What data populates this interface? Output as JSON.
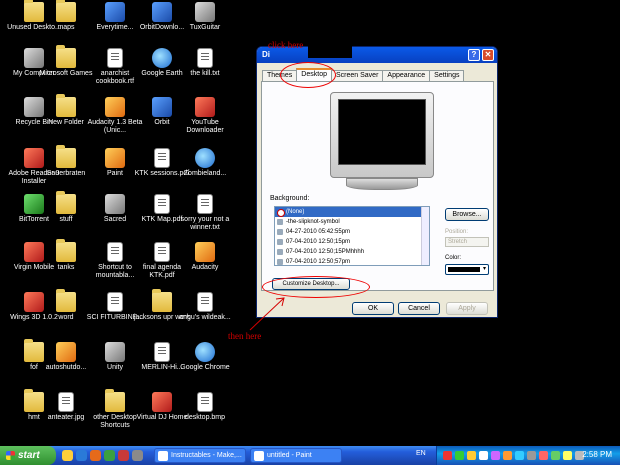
{
  "desktop": {
    "icons": [
      {
        "label": "Unused Deskto..."
      },
      {
        "label": "maps"
      },
      {
        "label": "Everytime..."
      },
      {
        "label": "OrbitDownlo..."
      },
      {
        "label": "TuxGuitar"
      },
      {
        "label": "My Computer"
      },
      {
        "label": "Microsoft Games"
      },
      {
        "label": "anarchist cookbook.rtf"
      },
      {
        "label": "Google Earth"
      },
      {
        "label": "the kill.txt"
      },
      {
        "label": "Recycle Bin"
      },
      {
        "label": "New Folder"
      },
      {
        "label": "Audacity 1.3 Beta (Unic..."
      },
      {
        "label": "Orbit"
      },
      {
        "label": "YouTube Downloader"
      },
      {
        "label": "Adobe Reader 9 Installer"
      },
      {
        "label": "Sauerbraten"
      },
      {
        "label": "Paint"
      },
      {
        "label": "KTK sessions.pdf"
      },
      {
        "label": "Zombieland..."
      },
      {
        "label": "BitTorrent"
      },
      {
        "label": "stuff"
      },
      {
        "label": "Sacred"
      },
      {
        "label": "KTK Map.pdf"
      },
      {
        "label": "sorry your not a winner.txt"
      },
      {
        "label": "Virgin Mobile"
      },
      {
        "label": "tanks"
      },
      {
        "label": "Shortcut to mountabla..."
      },
      {
        "label": "final agenda KTK.pdf"
      },
      {
        "label": "Audacity"
      },
      {
        "label": "Wings 3D 1.0.2"
      },
      {
        "label": "word"
      },
      {
        "label": "SCI FITURBINE..."
      },
      {
        "label": "jacksons upr work"
      },
      {
        "label": "angu's wildeak..."
      },
      {
        "label": "fof"
      },
      {
        "label": "autoshutdo..."
      },
      {
        "label": "Unity"
      },
      {
        "label": "MERLIN-Hi..."
      },
      {
        "label": "Google Chrome"
      },
      {
        "label": "hmt"
      },
      {
        "label": "anteater.jpg"
      },
      {
        "label": "other Desktop Shortcuts"
      },
      {
        "label": "Virtual DJ Home"
      },
      {
        "label": "desktop.bmp"
      }
    ]
  },
  "dialog": {
    "title": "Di",
    "help_glyph": "?",
    "close_glyph": "✕",
    "tabs": [
      "Themes",
      "Desktop",
      "Screen Saver",
      "Appearance",
      "Settings"
    ],
    "background_label": "Background:",
    "background_items": [
      "(None)",
      "-the-slipknot-symbol",
      "04-27-2010 05:42:55pm",
      "07-04-2010 12:50;15pm",
      "07-04-2010 12:50;15PMhhhh",
      "07-04-2010 12:50;57pm"
    ],
    "browse_label": "Browse...",
    "position_label": "Position:",
    "position_value": "Stretch",
    "color_label": "Color:",
    "customize_label": "Customize Desktop...",
    "ok_label": "OK",
    "cancel_label": "Cancel",
    "apply_label": "Apply"
  },
  "annotations": {
    "click_here": "click here",
    "then_here": "then here",
    "color": "#d40000"
  },
  "taskbar": {
    "start_label": "start",
    "tasks": [
      "Instructables - Make,...",
      "untitled - Paint"
    ],
    "language": "EN",
    "clock": "2:58 PM"
  }
}
